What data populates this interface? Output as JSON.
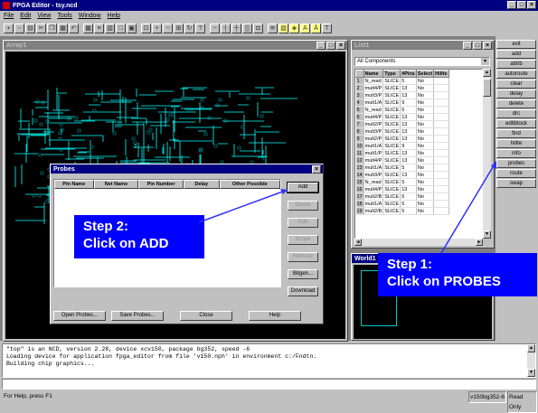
{
  "app": {
    "title": "FPGA Editor - tsy.ncd"
  },
  "menu": [
    "File",
    "Edit",
    "View",
    "Tools",
    "Window",
    "Help"
  ],
  "toolbar_icons": [
    "save-icon",
    "open-icon",
    "print-icon",
    "cut-icon",
    "copy-icon",
    "paste-icon",
    "undo-icon",
    "grid-icon",
    "list-icon",
    "table-icon",
    "window-icon",
    "tile-icon",
    "zoom-fit-icon",
    "zoom-in-icon",
    "zoom-out-icon",
    "zoom-area-icon",
    "refresh-icon",
    "help-arrow-icon",
    "minus-icon",
    "wire-icon",
    "route-icon",
    "hilite-icon",
    "component-icon",
    "net-icon",
    "macro-icon",
    "probe-icon",
    "label-icon",
    "font-icon",
    "text-icon"
  ],
  "array_window": {
    "title": "Array1"
  },
  "list_window": {
    "title": "List1",
    "filter": "All Components",
    "columns": [
      "",
      "Name",
      "Type",
      "#Pins",
      "Select",
      "Hilite"
    ],
    "rows": [
      [
        "1",
        "N_read",
        "SLICE",
        "5",
        "No"
      ],
      [
        "2",
        "mult4/P",
        "SLICE",
        "13",
        "No"
      ],
      [
        "3",
        "mult3/P",
        "SLICE",
        "13",
        "No"
      ],
      [
        "4",
        "mult1/A",
        "SLICE",
        "9",
        "No"
      ],
      [
        "5",
        "N_read",
        "SLICE",
        "5",
        "No"
      ],
      [
        "6",
        "mult4/P",
        "SLICE",
        "13",
        "No"
      ],
      [
        "7",
        "mult2/P",
        "SLICE",
        "13",
        "No"
      ],
      [
        "8",
        "mult3/P",
        "SLICE",
        "13",
        "No"
      ],
      [
        "9",
        "mult2/P",
        "SLICE",
        "13",
        "No"
      ],
      [
        "10",
        "mult1/A",
        "SLICE",
        "9",
        "No"
      ],
      [
        "11",
        "mult1/P",
        "SLICE",
        "13",
        "No"
      ],
      [
        "12",
        "mult4/P",
        "SLICE",
        "13",
        "No"
      ],
      [
        "13",
        "mult1/A",
        "SLICE",
        "5",
        "No"
      ],
      [
        "14",
        "mult3/P",
        "SLICE",
        "13",
        "No"
      ],
      [
        "15",
        "N_read",
        "SLICE",
        "5",
        "No"
      ],
      [
        "16",
        "mult4/P",
        "SLICE",
        "13",
        "No"
      ],
      [
        "17",
        "mult2/B",
        "SLICE",
        "5",
        "No"
      ],
      [
        "18",
        "mult1/A",
        "SLICE",
        "5",
        "No"
      ],
      [
        "19",
        "mult2/B",
        "SLICE",
        "5",
        "No"
      ]
    ]
  },
  "side_buttons": [
    "exit",
    "add",
    "attrib",
    "autoroute",
    "clear",
    "delay",
    "delete",
    "drc",
    "editblock",
    "find",
    "hilite",
    "info",
    "probes",
    "route",
    "swap"
  ],
  "world_window": {
    "title": "World1"
  },
  "probes_dialog": {
    "title": "Probes",
    "columns": [
      "Pin Name",
      "Net Name",
      "Pin Number",
      "Delay",
      "Other Possible"
    ],
    "right_buttons": [
      "Add",
      "Delete",
      "Edit",
      "Scope",
      "Remove",
      "Bitgen...",
      "Download"
    ],
    "bottom_buttons": [
      "Open Probes...",
      "Save Probes...",
      "Close",
      "Help"
    ]
  },
  "callouts": {
    "step2": {
      "line1": "Step 2:",
      "line2": "Click on ADD"
    },
    "step1": {
      "line1": "Step 1:",
      "line2": "Click on PROBES"
    }
  },
  "console": {
    "lines": [
      "\"top\" is an NCD, version 2.28, device xcv150, package bg352, speed -6",
      "Loading device for application fpga_editor from file 'v150.nph' in environment c:/Fndtn.",
      "Building chip graphics..."
    ]
  },
  "status": {
    "left": "For Help, press F1",
    "device": "v150bg352-6",
    "mode": "Read Only"
  },
  "colors": {
    "titlebar": "#000080",
    "callout": "#0000ff",
    "routing": "#00ffff",
    "arrow": "#3030ff"
  }
}
